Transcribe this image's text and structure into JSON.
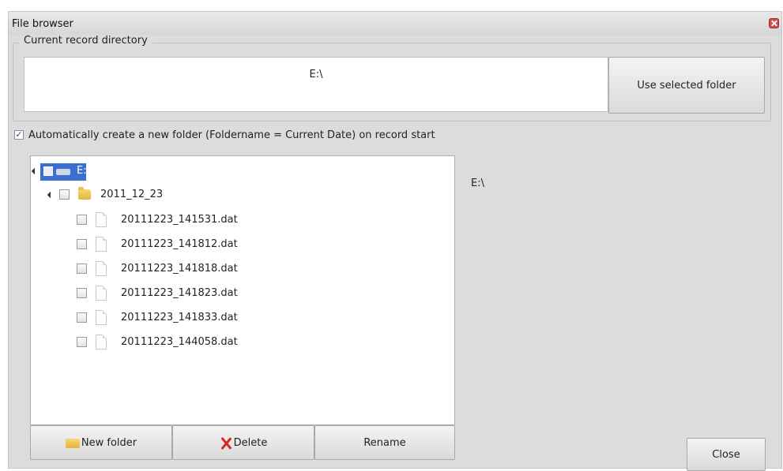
{
  "window": {
    "title": "File browser"
  },
  "record_directory": {
    "legend": "Current record directory",
    "value": "E:\\",
    "use_button": "Use selected folder"
  },
  "auto_folder": {
    "checked": true,
    "label": "Automatically create a new folder (Foldername = Current Date) on record start"
  },
  "tree": {
    "root": {
      "label": "E:",
      "expanded": true,
      "selected": true,
      "icon": "drive-icon"
    },
    "folder": {
      "label": "2011_12_23",
      "expanded": true,
      "checked": false,
      "icon": "folder-icon"
    },
    "files": [
      {
        "label": "20111223_141531.dat",
        "checked": false
      },
      {
        "label": "20111223_141812.dat",
        "checked": false
      },
      {
        "label": "20111223_141818.dat",
        "checked": false
      },
      {
        "label": "20111223_141823.dat",
        "checked": false
      },
      {
        "label": "20111223_141833.dat",
        "checked": false
      },
      {
        "label": "20111223_144058.dat",
        "checked": false
      }
    ]
  },
  "selected_path": "E:\\",
  "buttons": {
    "new_folder": "New folder",
    "delete": "Delete",
    "rename": "Rename",
    "close": "Close"
  },
  "colors": {
    "selection": "#3b6fd0",
    "window_bg": "#dcdcdc",
    "delete_icon": "#d42a1f"
  }
}
